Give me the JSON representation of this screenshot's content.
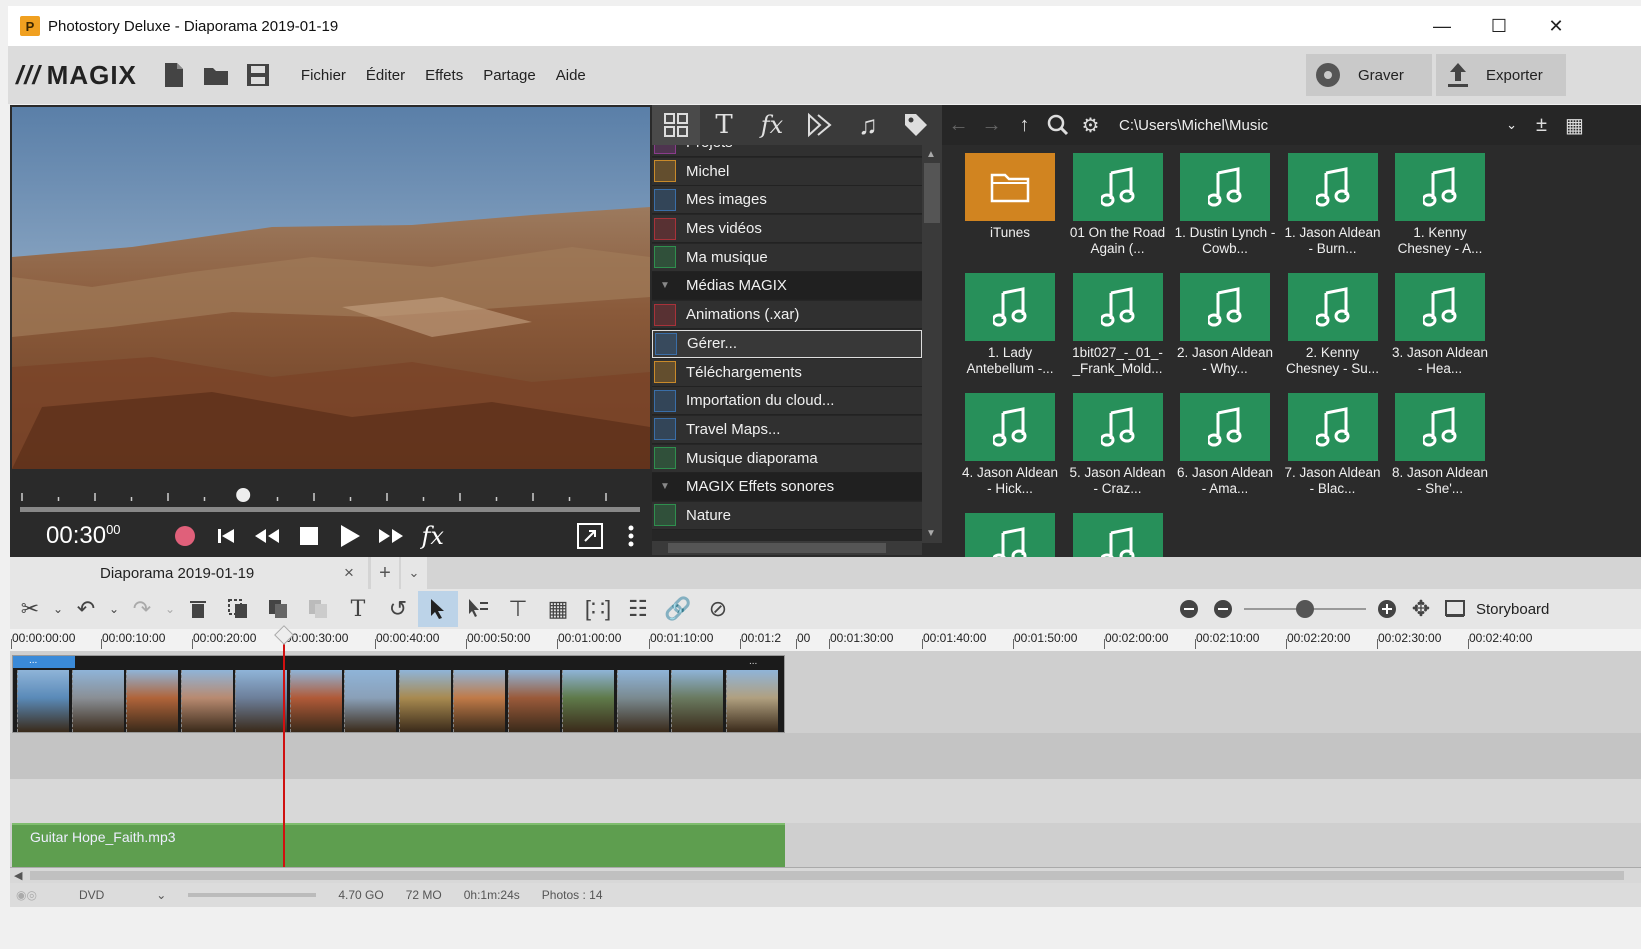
{
  "window": {
    "title": "Photostory Deluxe - Diaporama 2019-01-19",
    "app_icon": "P",
    "controls": [
      "minimize-icon",
      "maximize-icon",
      "close-icon"
    ]
  },
  "menubar": {
    "logo": "MAGIX",
    "logo_mark": "///",
    "file_icons": [
      "new-file-icon",
      "open-folder-icon",
      "save-icon"
    ],
    "menus": [
      "Fichier",
      "Éditer",
      "Effets",
      "Partage",
      "Aide"
    ],
    "burn_label": "Graver",
    "export_label": "Exporter"
  },
  "player": {
    "timecode": "00:30",
    "timecode_frames": "00",
    "fx_label": "fx",
    "progress": 0.36
  },
  "media_pool": {
    "tabs": [
      "grid-icon",
      "text-icon",
      "fx-icon",
      "transition-icon",
      "music-icon",
      "tag-icon"
    ],
    "path": "C:\\Users\\Michel\\Music",
    "tree": [
      {
        "label": "Projets",
        "icon": "projects-icon",
        "color": "#8a3c8c"
      },
      {
        "label": "Michel",
        "icon": "user-icon",
        "color": "#c98a2a"
      },
      {
        "label": "Mes images",
        "icon": "images-icon",
        "color": "#3a6ea8"
      },
      {
        "label": "Mes vidéos",
        "icon": "video-icon",
        "color": "#a8323a"
      },
      {
        "label": "Ma musique",
        "icon": "music-icon",
        "color": "#2f8f4e"
      },
      {
        "label": "Médias MAGIX",
        "icon": "collapse-icon",
        "group": true
      },
      {
        "label": "Animations (.xar)",
        "icon": "animation-icon",
        "color": "#a8323a"
      },
      {
        "label": "Gérer...",
        "icon": "manage-icon",
        "color": "#3a6ea8",
        "selected": true
      },
      {
        "label": "Téléchargements",
        "icon": "download-icon",
        "color": "#c98a2a"
      },
      {
        "label": "Importation du cloud...",
        "icon": "cloud-icon",
        "color": "#3a6ea8"
      },
      {
        "label": "Travel Maps...",
        "icon": "map-pin-icon",
        "color": "#3a6ea8"
      },
      {
        "label": "Musique diaporama",
        "icon": "music-icon",
        "color": "#2f8f4e"
      },
      {
        "label": "MAGIX Effets sonores",
        "icon": "collapse-icon",
        "group": true
      },
      {
        "label": "Nature",
        "icon": "music-icon",
        "color": "#2f8f4e"
      }
    ],
    "files": [
      {
        "label": "iTunes",
        "type": "folder"
      },
      {
        "label": "01 On the Road Again (...",
        "type": "music"
      },
      {
        "label": "1. Dustin Lynch - Cowb...",
        "type": "music"
      },
      {
        "label": "1. Jason Aldean - Burn...",
        "type": "music"
      },
      {
        "label": "1. Kenny Chesney - A...",
        "type": "music"
      },
      {
        "label": "1. Lady Antebellum -...",
        "type": "music"
      },
      {
        "label": "1bit027_-_01_-_Frank_Mold...",
        "type": "music"
      },
      {
        "label": "2. Jason Aldean - Why...",
        "type": "music"
      },
      {
        "label": "2. Kenny Chesney - Su...",
        "type": "music"
      },
      {
        "label": "3. Jason Aldean - Hea...",
        "type": "music"
      },
      {
        "label": "4. Jason Aldean - Hick...",
        "type": "music"
      },
      {
        "label": "5. Jason Aldean - Craz...",
        "type": "music"
      },
      {
        "label": "6. Jason Aldean - Ama...",
        "type": "music"
      },
      {
        "label": "7. Jason Aldean - Blac...",
        "type": "music"
      },
      {
        "label": "8. Jason Aldean - She'...",
        "type": "music"
      },
      {
        "label": "",
        "type": "music"
      },
      {
        "label": "",
        "type": "music"
      }
    ]
  },
  "timeline": {
    "tab_label": "Diaporama 2019-01-19",
    "tab_close": "×",
    "add_tab": "+",
    "view_mode": "Storyboard",
    "ruler": [
      "00:00:00:00",
      "00:00:10:00",
      "00:00:20:00",
      "00:00:30:00",
      "00:00:40:00",
      "00:00:50:00",
      "00:01:00:00",
      "00:01:10:00",
      "00:01:2",
      "00",
      "00:01:30:00",
      "00:01:40:00",
      "00:01:50:00",
      "00:02:00:00",
      "00:02:10:00",
      "00:02:20:00",
      "00:02:30:00",
      "00:02:40:00"
    ],
    "clip_marker": "...",
    "clip_colors": [
      "#5a8ab8",
      "#8a8f95",
      "#b0643a",
      "#b88a70",
      "#6d7f9a",
      "#b05a38",
      "#8aa0b8",
      "#a88a50",
      "#c07a48",
      "#9a5a3a",
      "#5f7a4a",
      "#7a8a90",
      "#6a7a60",
      "#b0a080"
    ],
    "audio_label": "Guitar Hope_Faith.mp3",
    "zoom_level": 0.5
  },
  "status": {
    "format": "DVD",
    "disc_size": "4.70 GO",
    "project_size": "72 MO",
    "duration": "0h:1m:24s",
    "photos": "Photos : 14"
  }
}
